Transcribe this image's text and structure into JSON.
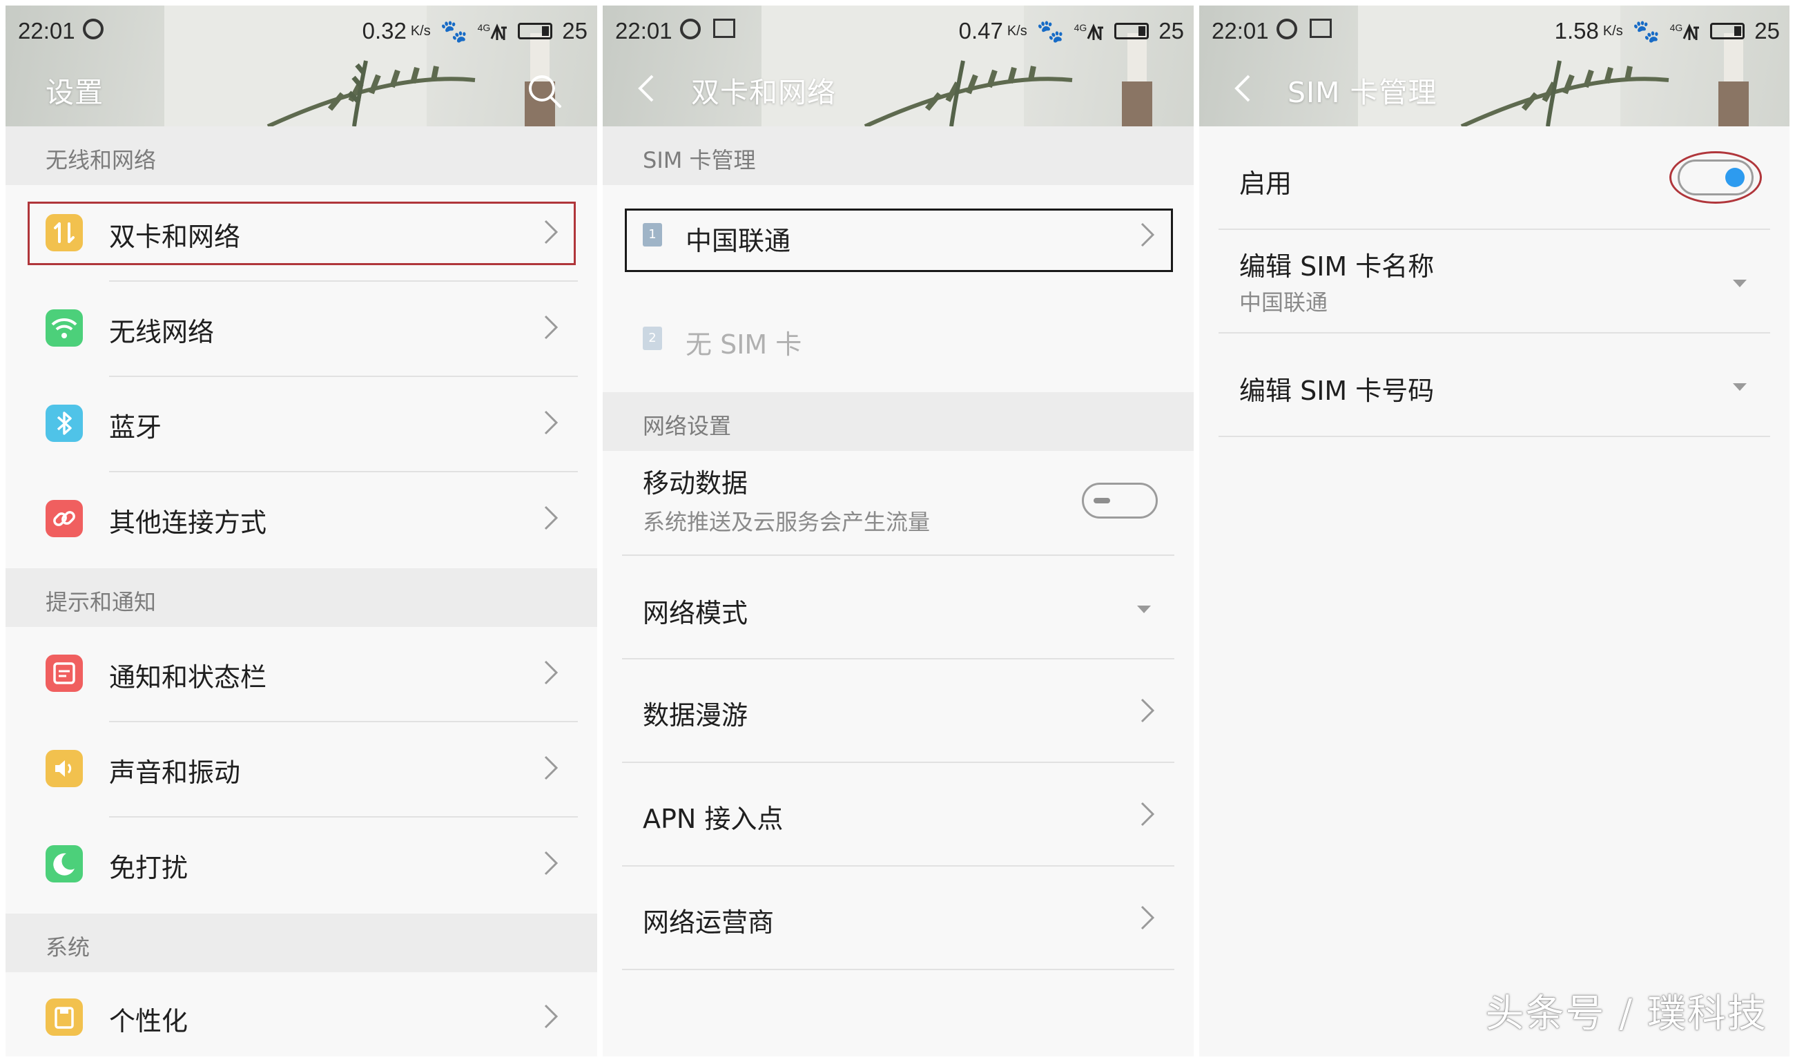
{
  "status_bar": [
    {
      "time": "22:01",
      "speed": "0.32",
      "speed_unit": "K/s",
      "battery": "25",
      "network": "4G"
    },
    {
      "time": "22:01",
      "speed": "0.47",
      "speed_unit": "K/s",
      "battery": "25",
      "network": "4G"
    },
    {
      "time": "22:01",
      "speed": "1.58",
      "speed_unit": "K/s",
      "battery": "25",
      "network": "4G"
    }
  ],
  "settings": {
    "title": "设置",
    "sections": [
      {
        "header": "无线和网络",
        "items": [
          {
            "label": "双卡和网络",
            "icon": "dual-sim-icon",
            "color": "#f2c14e"
          },
          {
            "label": "无线网络",
            "icon": "wifi-icon",
            "color": "#4cd07a"
          },
          {
            "label": "蓝牙",
            "icon": "bluetooth-icon",
            "color": "#4fc3e8"
          },
          {
            "label": "其他连接方式",
            "icon": "link-icon",
            "color": "#f05f5f"
          }
        ]
      },
      {
        "header": "提示和通知",
        "items": [
          {
            "label": "通知和状态栏",
            "icon": "notification-icon",
            "color": "#f05f5f"
          },
          {
            "label": "声音和振动",
            "icon": "sound-icon",
            "color": "#f2c14e"
          },
          {
            "label": "免打扰",
            "icon": "moon-icon",
            "color": "#4cd07a"
          }
        ]
      },
      {
        "header": "系统",
        "items": [
          {
            "label": "个性化",
            "icon": "personalize-icon",
            "color": "#f2c14e"
          }
        ]
      }
    ]
  },
  "dual_sim": {
    "title": "双卡和网络",
    "sim_header": "SIM 卡管理",
    "sim1": {
      "slot": "1",
      "label": "中国联通"
    },
    "sim2": {
      "slot": "2",
      "label": "无 SIM 卡"
    },
    "network_header": "网络设置",
    "mobile_data": {
      "label": "移动数据",
      "sub": "系统推送及云服务会产生流量",
      "enabled": false
    },
    "network_mode": "网络模式",
    "data_roaming": "数据漫游",
    "apn": "APN 接入点",
    "carrier": "网络运营商"
  },
  "sim_manage": {
    "title": "SIM 卡管理",
    "enable": {
      "label": "启用",
      "enabled": true
    },
    "edit_name": {
      "label": "编辑 SIM 卡名称",
      "value": "中国联通"
    },
    "edit_number": {
      "label": "编辑 SIM 卡号码"
    }
  },
  "colors": {
    "highlight": "#b0363b",
    "toggle_on": "#2d9bef"
  },
  "watermark": "头条号 / 璞科技"
}
